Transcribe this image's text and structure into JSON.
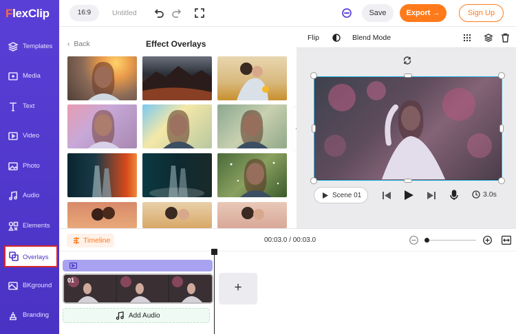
{
  "app": {
    "logo": "FlexClip",
    "ratio": "16:9",
    "project_title": "Untitled",
    "save": "Save",
    "export": "Export",
    "signup": "Sign Up"
  },
  "sidebar": {
    "items": [
      {
        "label": "Templates",
        "icon": "layers-icon"
      },
      {
        "label": "Media",
        "icon": "media-folder-icon"
      },
      {
        "label": "Text",
        "icon": "text-icon"
      },
      {
        "label": "Video",
        "icon": "video-icon"
      },
      {
        "label": "Photo",
        "icon": "photo-icon"
      },
      {
        "label": "Audio",
        "icon": "audio-icon"
      },
      {
        "label": "Elements",
        "icon": "elements-icon"
      },
      {
        "label": "Overlays",
        "icon": "overlays-icon",
        "active": true
      },
      {
        "label": "BKground",
        "icon": "background-icon"
      },
      {
        "label": "Branding",
        "icon": "branding-icon"
      }
    ]
  },
  "panel": {
    "back": "Back",
    "title": "Effect Overlays"
  },
  "preview": {
    "flip": "Flip",
    "blend_mode": "Blend Mode",
    "scene": "Scene 01",
    "duration": "3.0s"
  },
  "timeline": {
    "tab": "Timeline",
    "timecode": "00:03.0 / 00:03.0",
    "clip_label": "01",
    "add_audio": "Add Audio",
    "add_scene": "+"
  },
  "colors": {
    "brand": "#4a32c4",
    "accent": "#ff7a1a",
    "selection": "#29b8e6"
  }
}
